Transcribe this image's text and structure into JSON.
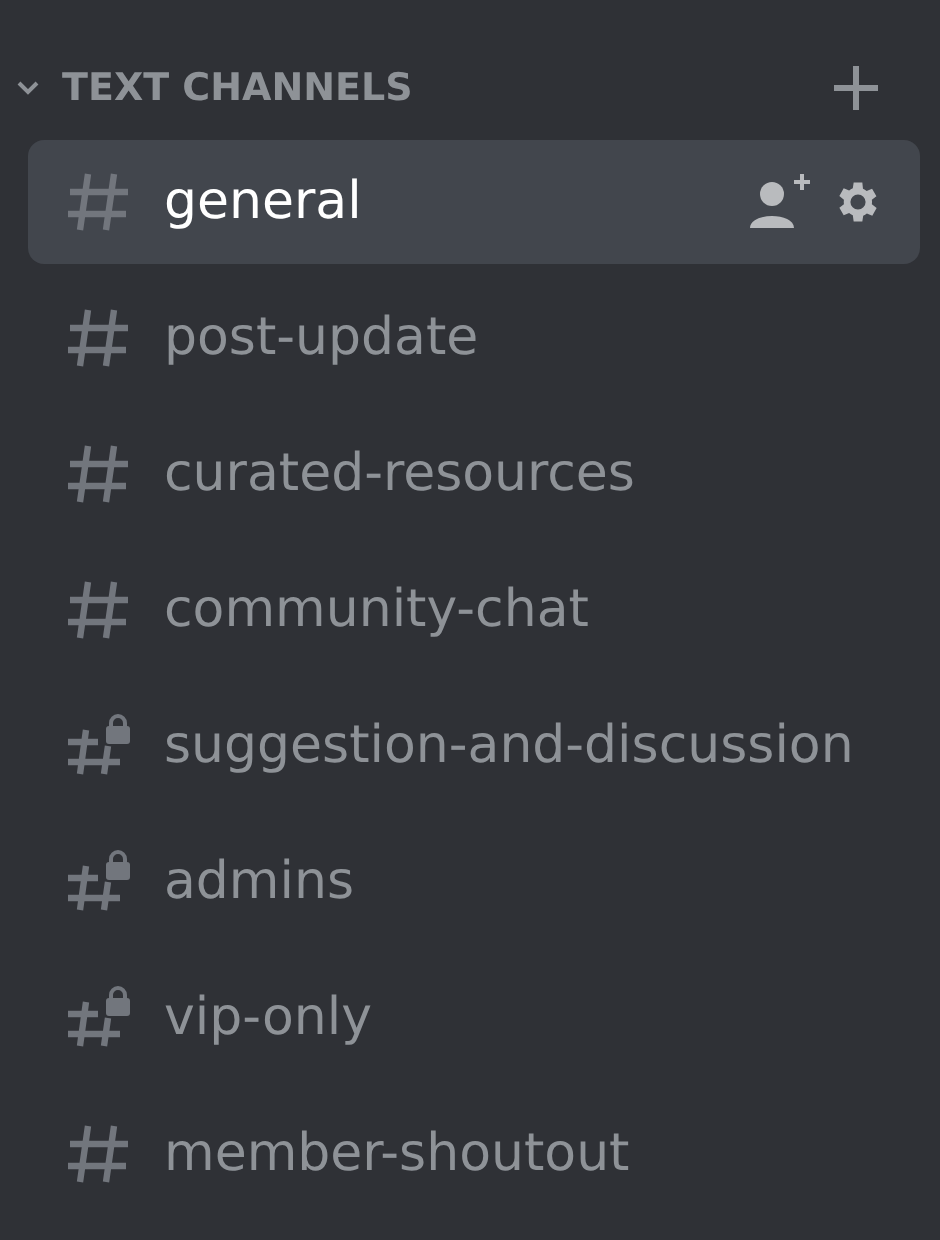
{
  "category": {
    "title": "TEXT CHANNELS",
    "expanded": true
  },
  "channels": [
    {
      "name": "general",
      "selected": true,
      "locked": false
    },
    {
      "name": "post-update",
      "selected": false,
      "locked": false
    },
    {
      "name": "curated-resources",
      "selected": false,
      "locked": false
    },
    {
      "name": "community-chat",
      "selected": false,
      "locked": false
    },
    {
      "name": "suggestion-and-discussion",
      "selected": false,
      "locked": true
    },
    {
      "name": "admins",
      "selected": false,
      "locked": true
    },
    {
      "name": "vip-only",
      "selected": false,
      "locked": true
    },
    {
      "name": "member-shoutout",
      "selected": false,
      "locked": false
    }
  ]
}
